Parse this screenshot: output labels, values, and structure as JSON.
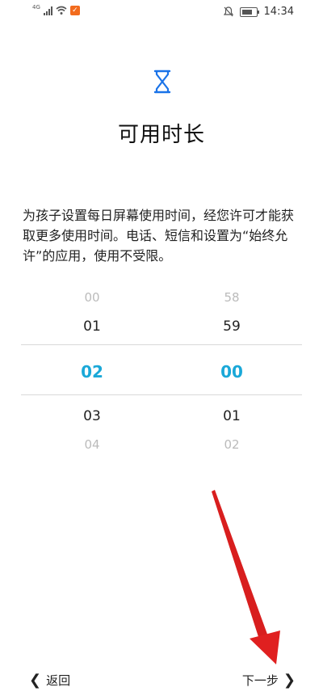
{
  "status_bar": {
    "signal_label": "4G",
    "time": "14:34",
    "icons": [
      "signal-icon",
      "wifi-icon",
      "app-notification-icon",
      "mute-icon",
      "battery-icon"
    ]
  },
  "page": {
    "icon": "hourglass-icon",
    "title": "可用时长",
    "description": "为孩子设置每日屏幕使用时间，经您许可才能获取更多使用时间。电话、短信和设置为“始终允许”的应用，使用不受限。"
  },
  "picker": {
    "hours": {
      "far_above": "00",
      "above": "01",
      "selected": "02",
      "below": "03",
      "far_below": "04"
    },
    "minutes": {
      "far_above": "58",
      "above": "59",
      "selected": "00",
      "below": "01",
      "far_below": "02"
    }
  },
  "nav": {
    "back_label": "返回",
    "next_label": "下一步"
  },
  "colors": {
    "accent": "#1aa8d8",
    "annotation_arrow": "#e02020"
  }
}
